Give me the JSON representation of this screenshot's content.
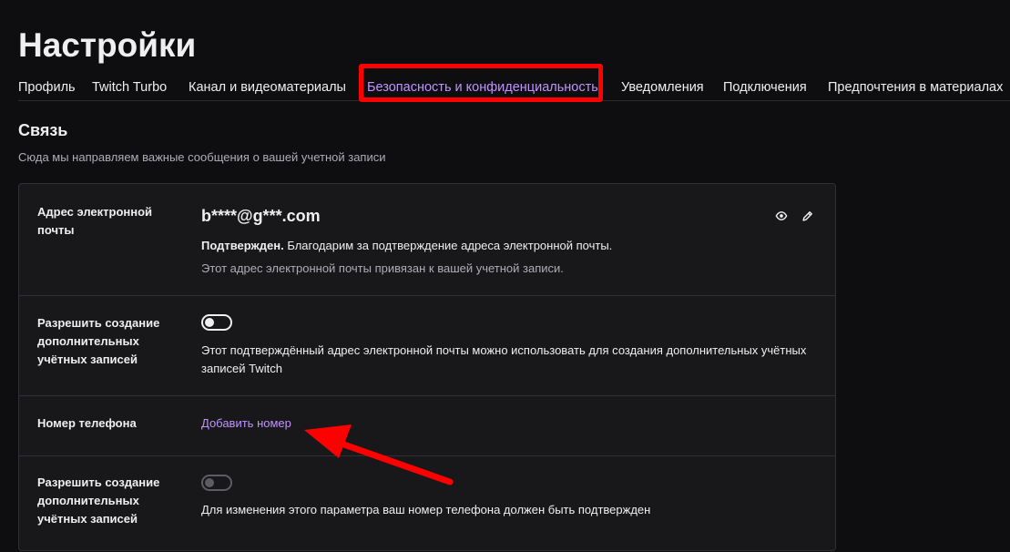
{
  "page": {
    "title": "Настройки"
  },
  "tabs": [
    {
      "label": "Профиль"
    },
    {
      "label": "Twitch Turbo"
    },
    {
      "label": "Канал и видеоматериалы"
    },
    {
      "label": "Безопасность и конфиденциальность"
    },
    {
      "label": "Уведомления"
    },
    {
      "label": "Подключения"
    },
    {
      "label": "Предпочтения в материалах"
    }
  ],
  "section": {
    "title": "Связь",
    "description": "Сюда мы направляем важные сообщения о вашей учетной записи"
  },
  "email_row": {
    "label": "Адрес электронной почты",
    "value": "b****@g***.com",
    "status_bold": "Подтвержден.",
    "status_text": " Благодарим за подтверждение адреса электронной почты.",
    "note": "Этот адрес электронной почты привязан к вашей учетной записи."
  },
  "email_accounts_row": {
    "label": "Разрешить создание дополнительных учётных записей",
    "toggle_on": false,
    "description": "Этот подтверждённый адрес электронной почты можно использовать для создания дополнительных учётных записей Twitch"
  },
  "phone_row": {
    "label": "Номер телефона",
    "link": "Добавить номер"
  },
  "phone_accounts_row": {
    "label": "Разрешить создание дополнительных учётных записей",
    "toggle_on": false,
    "toggle_disabled": true,
    "description": "Для изменения этого параметра ваш номер телефона должен быть подтвержден"
  },
  "colors": {
    "background": "#0e0e10",
    "card": "#18181b",
    "accent": "#bf94ff",
    "annotation": "#ff0000"
  },
  "icons": {
    "show_email": "eye-icon",
    "edit_email": "pencil-icon"
  }
}
